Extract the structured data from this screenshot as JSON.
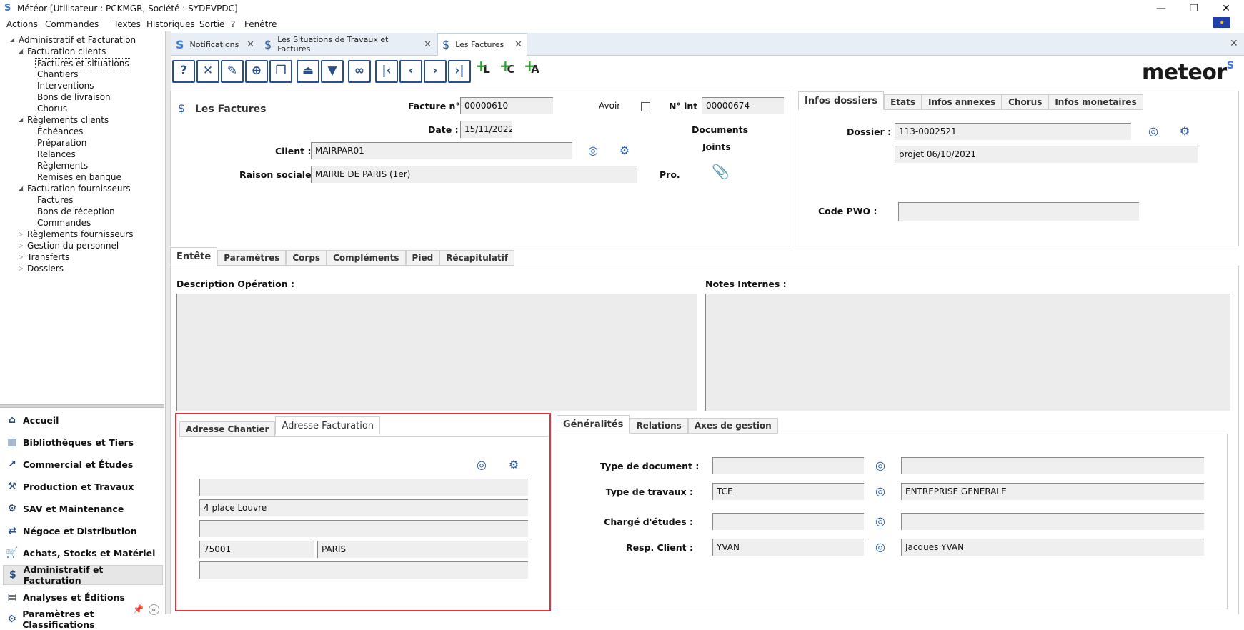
{
  "window": {
    "title": "Météor [Utilisateur : PCKMGR, Société : SYDEVPDC]",
    "minimize": "—",
    "restore": "❐",
    "close": "✕"
  },
  "menu": [
    "Actions",
    "Commandes",
    "Textes",
    "Historiques",
    "Sortie",
    "?",
    "Fenêtre"
  ],
  "tree": [
    {
      "label": "Administratif et Facturation",
      "level": 0,
      "expanded": true
    },
    {
      "label": "Facturation clients",
      "level": 1,
      "expanded": true
    },
    {
      "label": "Factures et situations",
      "level": 2,
      "selected": true
    },
    {
      "label": "Chantiers",
      "level": 2
    },
    {
      "label": "Interventions",
      "level": 2
    },
    {
      "label": "Bons de livraison",
      "level": 2
    },
    {
      "label": "Chorus",
      "level": 2
    },
    {
      "label": "Règlements clients",
      "level": 1,
      "expanded": true
    },
    {
      "label": "Échéances",
      "level": 2
    },
    {
      "label": "Préparation",
      "level": 2
    },
    {
      "label": "Relances",
      "level": 2
    },
    {
      "label": "Règlements",
      "level": 2
    },
    {
      "label": "Remises en banque",
      "level": 2
    },
    {
      "label": "Facturation fournisseurs",
      "level": 1,
      "expanded": true
    },
    {
      "label": "Factures",
      "level": 2
    },
    {
      "label": "Bons de réception",
      "level": 2
    },
    {
      "label": "Commandes",
      "level": 2
    },
    {
      "label": "Règlements fournisseurs",
      "level": 1,
      "expanded": false
    },
    {
      "label": "Gestion du personnel",
      "level": 1,
      "expanded": false
    },
    {
      "label": "Transferts",
      "level": 1,
      "expanded": false
    },
    {
      "label": "Dossiers",
      "level": 1,
      "expanded": false
    }
  ],
  "nav": [
    {
      "label": "Accueil",
      "icon": "home-icon"
    },
    {
      "label": "Bibliothèques et Tiers",
      "icon": "library-icon"
    },
    {
      "label": "Commercial et Études",
      "icon": "chart-icon"
    },
    {
      "label": "Production et Travaux",
      "icon": "worker-icon"
    },
    {
      "label": "SAV et Maintenance",
      "icon": "wrench-icon"
    },
    {
      "label": "Négoce et Distribution",
      "icon": "trade-icon"
    },
    {
      "label": "Achats, Stocks et Matériel",
      "icon": "cart-icon"
    },
    {
      "label": "Administratif et Facturation",
      "icon": "admin-icon",
      "active": true
    },
    {
      "label": "Analyses et Éditions",
      "icon": "report-icon"
    },
    {
      "label": "Paramètres et Classifications",
      "icon": "settings-icon"
    }
  ],
  "doc_tabs": [
    {
      "label": "Notifications"
    },
    {
      "label": "Les Situations de Travaux et Factures"
    },
    {
      "label": "Les Factures",
      "selected": true
    }
  ],
  "brand": "meteor",
  "header": {
    "title": "Les Factures",
    "facture_label": "Facture n°",
    "facture_value": "00000610",
    "avoir_label": "Avoir",
    "nint_label": "N° int :",
    "nint_value": "00000674",
    "date_label": "Date :",
    "date_value": "15/11/2022",
    "documents_label": "Documents",
    "joints_label": "Joints",
    "client_label": "Client :",
    "client_value": "MAIRPAR01",
    "raison_label": "Raison sociale :",
    "raison_value": "MAIRIE DE PARIS (1er)",
    "pro_label": "Pro."
  },
  "dossiers": {
    "tabs": [
      "Infos dossiers",
      "Etats",
      "Infos annexes",
      "Chorus",
      "Infos monetaires"
    ],
    "dossier_label": "Dossier :",
    "dossier_value": "113-0002521",
    "dossier_desc": "projet 06/10/2021",
    "pwo_label": "Code PWO :",
    "pwo_value": ""
  },
  "main_tabs": [
    "Entête",
    "Paramètres",
    "Corps",
    "Compléments",
    "Pied",
    "Récapitulatif"
  ],
  "entete": {
    "desc_label": "Description Opération :",
    "notes_label": "Notes Internes :"
  },
  "address": {
    "tabs": [
      "Adresse Chantier",
      "Adresse Facturation"
    ],
    "line1": "",
    "line2": "4 place Louvre",
    "line3": "",
    "postcode": "75001",
    "city": "PARIS",
    "line5": ""
  },
  "generalites": {
    "tabs": [
      "Généralités",
      "Relations",
      "Axes de gestion"
    ],
    "rows": [
      {
        "label": "Type de document :",
        "code": "",
        "desc": ""
      },
      {
        "label": "Type de travaux :",
        "code": "TCE",
        "desc": "ENTREPRISE GENERALE"
      },
      {
        "label": "Chargé d'études :",
        "code": "",
        "desc": ""
      },
      {
        "label": "Resp. Client :",
        "code": "YVAN",
        "desc": "Jacques YVAN"
      }
    ]
  }
}
